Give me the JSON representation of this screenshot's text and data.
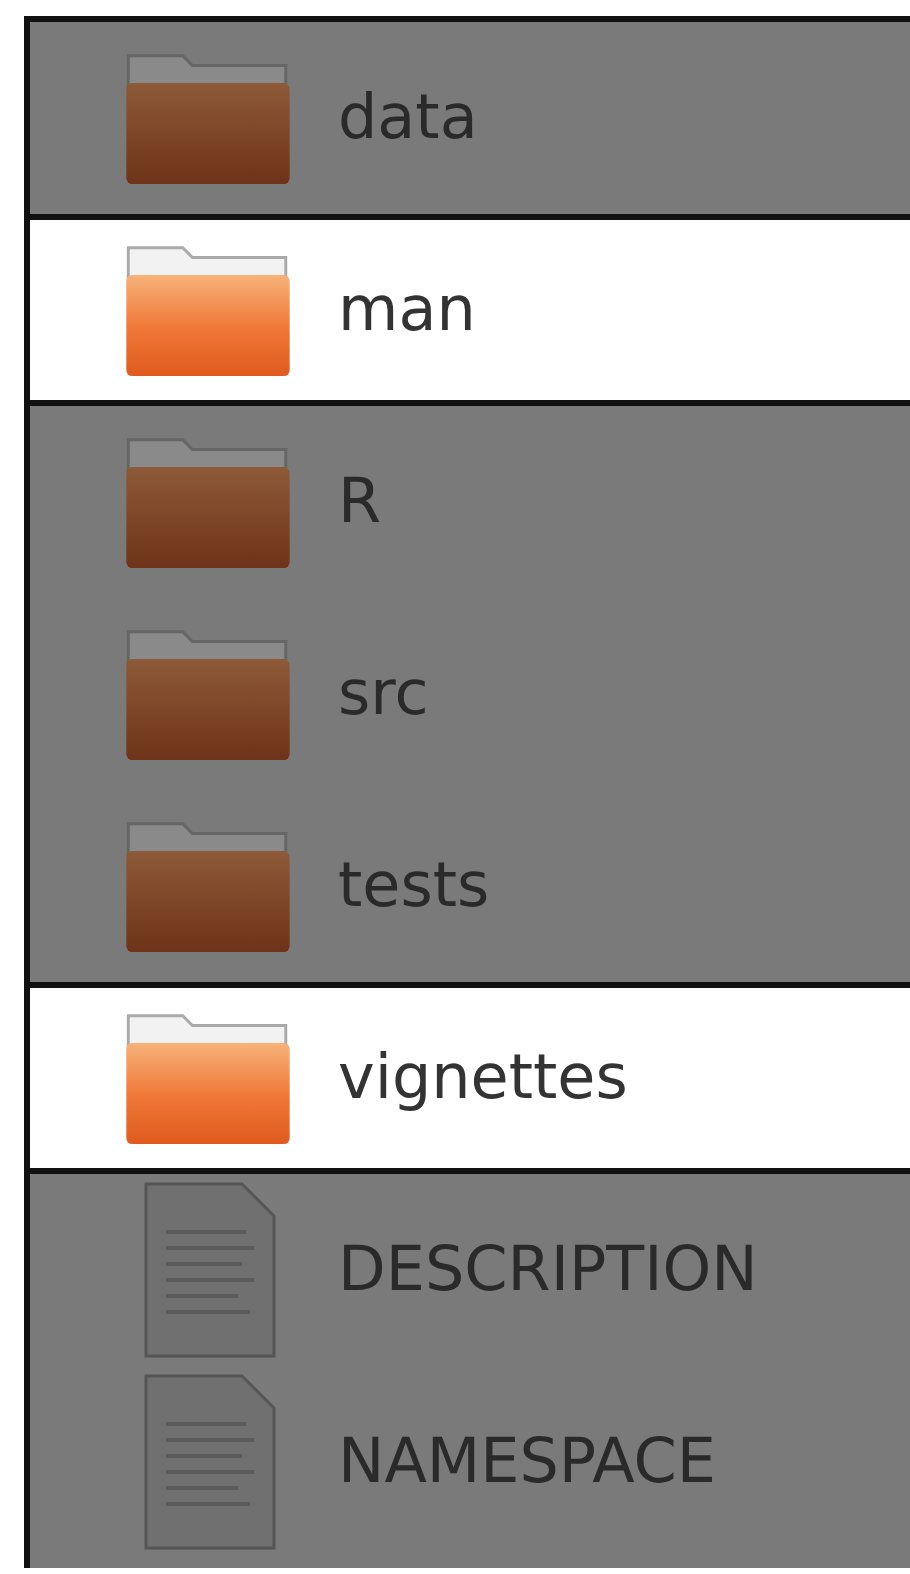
{
  "items": [
    {
      "name": "data",
      "kind": "folder",
      "selected": false
    },
    {
      "name": "man",
      "kind": "folder",
      "selected": true
    },
    {
      "name": "R",
      "kind": "folder",
      "selected": false
    },
    {
      "name": "src",
      "kind": "folder",
      "selected": false
    },
    {
      "name": "tests",
      "kind": "folder",
      "selected": false
    },
    {
      "name": "vignettes",
      "kind": "folder",
      "selected": true
    },
    {
      "name": "DESCRIPTION",
      "kind": "file",
      "selected": false
    },
    {
      "name": "NAMESPACE",
      "kind": "file",
      "selected": false
    }
  ]
}
